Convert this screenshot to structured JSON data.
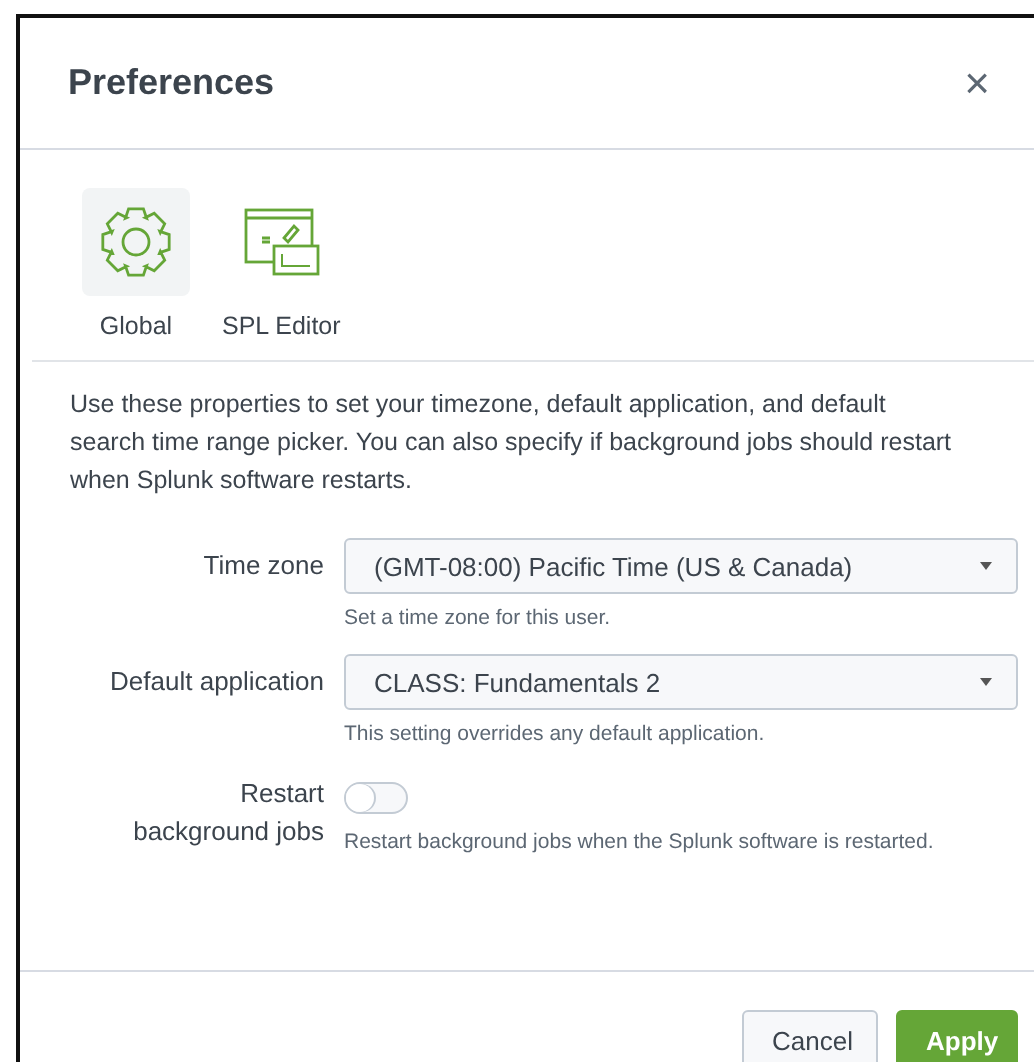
{
  "window": {
    "title": "Preferences",
    "close": "×"
  },
  "tabs": [
    {
      "label": "Global",
      "selected": true
    },
    {
      "label": "SPL Editor",
      "selected": false
    }
  ],
  "description": "Use these properties to set your timezone, default application, and default search time range picker. You can also specify if background jobs should restart when Splunk software restarts.",
  "fields": [
    {
      "kind": "select",
      "label": "Time zone",
      "value": "(GMT-08:00) Pacific Time (US & Canada)",
      "help": "Set a time zone for this user."
    },
    {
      "kind": "select",
      "label": "Default application",
      "value": "CLASS: Fundamentals 2",
      "help": "This setting overrides any default application."
    },
    {
      "kind": "toggle",
      "label": "Restart background jobs",
      "on": false,
      "help": "Restart background jobs when the Splunk software is restarted."
    }
  ],
  "buttons": [
    {
      "label": "Cancel",
      "kind": "secondary"
    },
    {
      "label": "Apply",
      "kind": "primary"
    }
  ]
}
